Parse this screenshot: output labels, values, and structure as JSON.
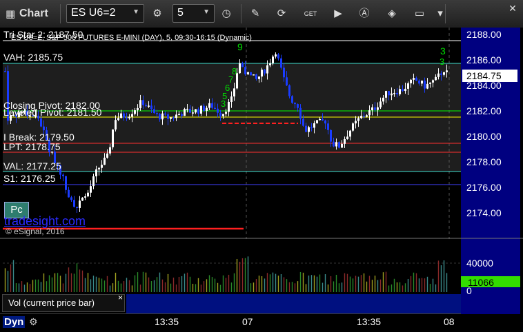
{
  "window": {
    "title": "Chart",
    "symbol": "ES U6=2",
    "interval": "5"
  },
  "chart": {
    "header": "ES U6=Z, S&P 500 FUTURES E-MINI (DAY), 5, 09:30-16:15 (Dynamic)",
    "watermark": "tradesight.com",
    "copyright": "© eSignal, 2016",
    "price_ticks": [
      "2188.00",
      "2186.00",
      "2184.00",
      "2182.00",
      "2180.00",
      "2178.00",
      "2176.00",
      "2174.00"
    ],
    "current_price": "2184.75",
    "time_labels": [
      "13:35",
      "07",
      "13:35",
      "08"
    ],
    "levels": [
      {
        "text": "Tri Star 2: 2187.50",
        "color": "#ffffff"
      },
      {
        "text": "VAH: 2185.75",
        "color": "#40e0d0"
      },
      {
        "text": "Closing Pivot: 2182.00",
        "color": "#00ff00"
      },
      {
        "text": "Leveled Pivot: 2181.50",
        "color": "#ffff00"
      },
      {
        "text": "I Break: 2179.50",
        "color": "#ff3030"
      },
      {
        "text": "LPT: 2178.75",
        "color": "#ff3030"
      },
      {
        "text": "VAL: 2177.25",
        "color": "#40e0d0"
      },
      {
        "text": "S1: 2176.25",
        "color": "#4040ff"
      }
    ],
    "badge": "Pc",
    "setup_numbers": [
      "9",
      "3",
      "8",
      "7",
      "6",
      "5",
      "3",
      "3"
    ]
  },
  "volume": {
    "ticks": [
      "40000",
      "0"
    ],
    "current": "11066",
    "caption": "Vol (current price bar)",
    "close_symbol": "×"
  },
  "footer": {
    "label": "Dyn"
  },
  "colors": {
    "up": "#ffffff",
    "down": "#1a3cff",
    "price_panel": "#000080",
    "current_badge": "#33dd00"
  }
}
